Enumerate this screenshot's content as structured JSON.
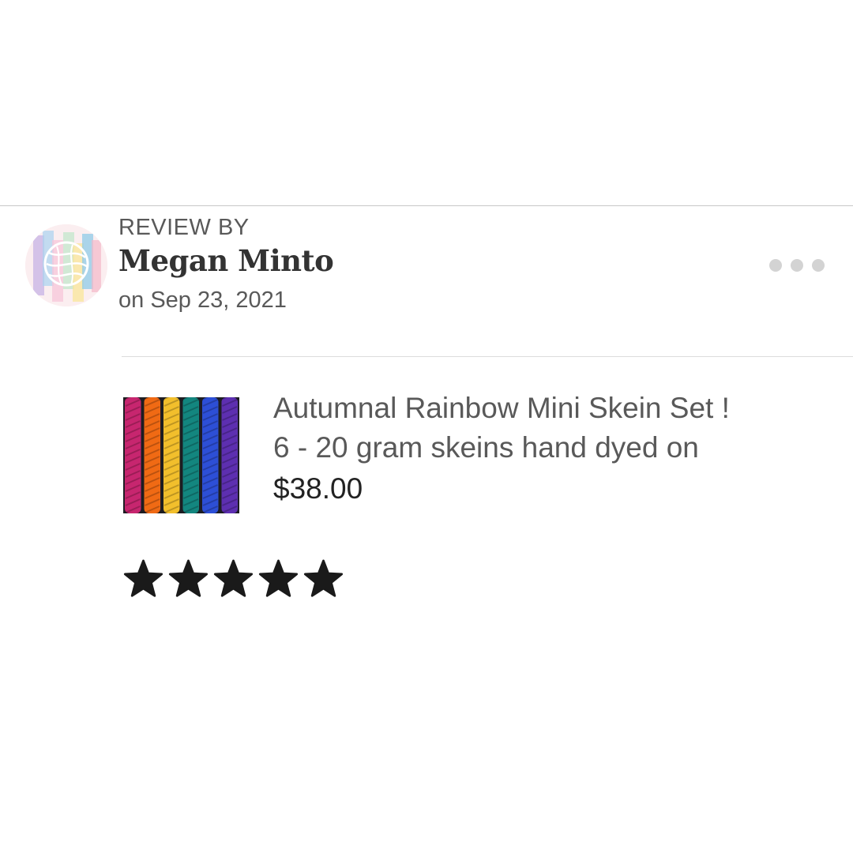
{
  "review": {
    "label": "REVIEW BY",
    "reviewer_name": "Megan Minto",
    "date": "on Sep 23, 2021",
    "more_icon": "more-horizontal-icon"
  },
  "product": {
    "title_line1": "Autumnal Rainbow Mini Skein Set !",
    "title_line2": "6 - 20 gram skeins hand dyed on",
    "price": "$38.00",
    "thumbnail_colors": [
      "#c7266f",
      "#f06a14",
      "#f2bf2c",
      "#13867f",
      "#2d4fd6",
      "#5d2fb0"
    ]
  },
  "rating": {
    "value": 5,
    "max": 5,
    "star_color": "#1a1a1a"
  },
  "colors": {
    "divider": "#c8c8c8",
    "muted_text": "#595959",
    "dots": "#d3d3d3"
  }
}
